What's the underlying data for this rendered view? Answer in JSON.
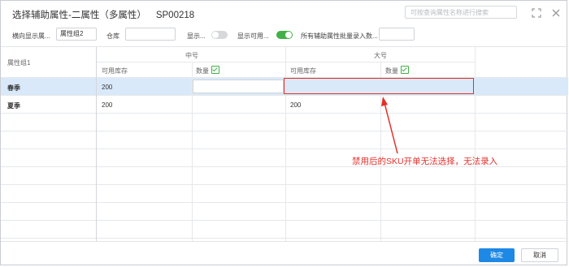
{
  "dialog": {
    "title": "选择辅助属性-二属性（多属性）",
    "code": "SP00218",
    "search_placeholder": "可按查询属性名称进行搜索"
  },
  "filters": {
    "horizontal_label": "横向显示属...",
    "horizontal_value": "属性组2",
    "warehouse_label": "仓库",
    "warehouse_value": "",
    "show_label": "显示...",
    "show_toggle_on": false,
    "show_available_label": "显示可用...",
    "show_available_toggle_on": true,
    "batch_label": "所有辅助属性批量录入数...",
    "batch_value": ""
  },
  "grid": {
    "row_header": "属性组1",
    "groups": [
      {
        "name": "中号",
        "columns": [
          "可用库存",
          "数量"
        ]
      },
      {
        "name": "大号",
        "columns": [
          "可用库存",
          "数量"
        ]
      }
    ],
    "rows": [
      {
        "label": "春季",
        "cells": [
          "200",
          "",
          "",
          ""
        ]
      },
      {
        "label": "夏季",
        "cells": [
          "200",
          "",
          "200",
          ""
        ]
      }
    ]
  },
  "annotation": {
    "text": "禁用后的SKU开单无法选择，无法录入",
    "color": "#e2302b"
  },
  "footer": {
    "confirm_label": "确定",
    "cancel_label": "取消"
  },
  "colors": {
    "accent": "#1e88e5",
    "toggle_on": "#43b047",
    "selected_row": "#d9e9fa"
  }
}
